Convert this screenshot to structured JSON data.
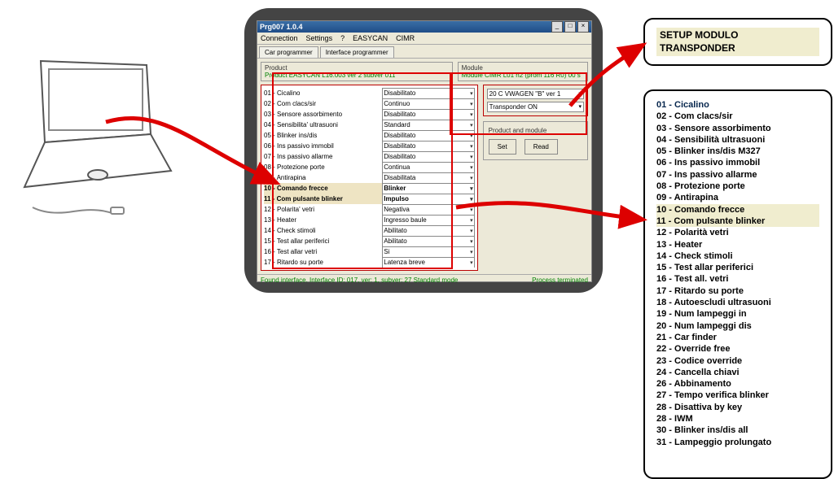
{
  "window": {
    "title": "Prg007 1.0.4",
    "menu": [
      "Connection",
      "Settings",
      "?",
      "EASYCAN",
      "CIMR"
    ],
    "tabs": [
      "Car programmer",
      "Interface programmer"
    ],
    "product_label": "Product",
    "product_line": "Product EASYCAN L16.003 ver 2 subver 011",
    "module_label": "Module",
    "module_line": "Module CIMR L01 n2 (prom 116 R0)  00 s",
    "module_select_top": "20  C  VWAGEN \"B\"    ver 1",
    "module_select_bottom": "Transponder ON",
    "pm_label": "Product and module",
    "btn_set": "Set",
    "btn_read": "Read",
    "status_left": "Found interface. Interface ID: 017, ver: 1, subver: 27  Standard mode",
    "status_right": "Process terminated"
  },
  "params": [
    {
      "label": "01 - Cicalino",
      "value": "Disabilitato"
    },
    {
      "label": "02 - Com clacs/sir",
      "value": "Continuo"
    },
    {
      "label": "03 - Sensore assorbimento",
      "value": "Disabilitato"
    },
    {
      "label": "04 - Sensibilita' ultrasuoni",
      "value": "Standard"
    },
    {
      "label": "05 - Blinker ins/dis",
      "value": "Disabilitato"
    },
    {
      "label": "06 - Ins passivo immobil",
      "value": "Disabilitato"
    },
    {
      "label": "07 - Ins passivo allarme",
      "value": "Disabilitato"
    },
    {
      "label": "08 - Protezione porte",
      "value": "Continua"
    },
    {
      "label": "09 - Antirapina",
      "value": "Disabilitata"
    },
    {
      "label": "10 - Comando frecce",
      "value": "Blinker",
      "hl": true
    },
    {
      "label": "11 - Com pulsante blinker",
      "value": "Impulso",
      "hl": true
    },
    {
      "label": "12 - Polarita' vetri",
      "value": "Negativa"
    },
    {
      "label": "13 - Heater",
      "value": "Ingresso baule"
    },
    {
      "label": "14 - Check stimoli",
      "value": "Abilitato"
    },
    {
      "label": "15 - Test allar periferici",
      "value": "Abilitato"
    },
    {
      "label": "16 - Test allar vetri",
      "value": "Si"
    },
    {
      "label": "17 - Ritardo su porte",
      "value": "Latenza breve"
    }
  ],
  "callout_title_line1": "SETUP MODULO",
  "callout_title_line2": "TRANSPONDER",
  "callout_list": [
    "01 - Cicalino",
    "02 - Com clacs/sir",
    "03 - Sensore assorbimento",
    "04 - Sensibilità ultrasuoni",
    "05 - Blinker ins/dis M327",
    "06 - Ins passivo immobil",
    "07 - Ins passivo allarme",
    "08 - Protezione porte",
    "09 - Antirapina",
    "10 - Comando frecce",
    "11 - Com pulsante blinker",
    "12 - Polarità vetri",
    "13 - Heater",
    "14 - Check stimoli",
    "15 - Test allar periferici",
    "16 - Test all. vetri",
    "17 - Ritardo su porte",
    "18 - Autoescludi ultrasuoni",
    "19 - Num lampeggi in",
    "20 - Num lampeggi dis",
    "21 - Car finder",
    "22 - Override free",
    "23 - Codice override",
    "24 - Cancella chiavi",
    "26 - Abbinamento",
    "27 - Tempo verifica blinker",
    "28 - Disattiva by key",
    "28 - IWM",
    "30 - Blinker ins/dis all",
    "31 - Lampeggio prolungato"
  ]
}
